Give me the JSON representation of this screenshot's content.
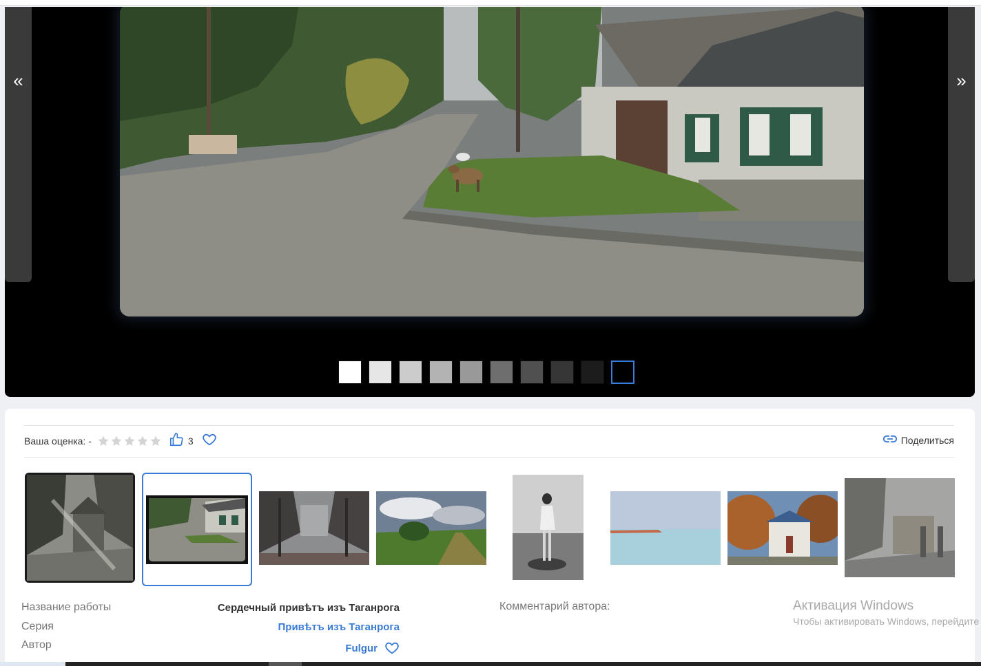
{
  "viewer": {
    "prev_label": "«",
    "next_label": "»",
    "background_swatches": [
      "#ffffff",
      "#e6e6e6",
      "#cccccc",
      "#b3b3b3",
      "#999999",
      "#6e6e6e",
      "#505050",
      "#363636",
      "#1c1c1c",
      "#000000"
    ],
    "active_swatch_index": 9
  },
  "toolbar": {
    "rating_label": "Ваша оценка: -",
    "star_count": 5,
    "like_count": "3",
    "share_label": "Поделиться"
  },
  "thumbnails": [
    {
      "name": "thumb-overgrown-church",
      "selected": false
    },
    {
      "name": "thumb-taganrog-street",
      "selected": true
    },
    {
      "name": "thumb-foggy-alley",
      "selected": false
    },
    {
      "name": "thumb-field-road",
      "selected": false
    },
    {
      "name": "thumb-woman-on-rock",
      "selected": false
    },
    {
      "name": "thumb-sea-horizon",
      "selected": false
    },
    {
      "name": "thumb-autumn-mansion",
      "selected": false
    },
    {
      "name": "thumb-snowy-street",
      "selected": false
    }
  ],
  "details": {
    "title_label": "Название работы",
    "series_label": "Серия",
    "author_label": "Автор",
    "title_value": "Сердечный привѣтъ изъ Таганрога",
    "series_value": "Привѣтъ изъ Таганрога",
    "author_value": "Fulgur",
    "comment_label": "Комментарий автора:"
  },
  "system": {
    "watermark_title": "Активация Windows",
    "watermark_sub": "Чтобы активировать Windows, перейдите"
  },
  "colors": {
    "accent": "#3a7bd5",
    "viewer_bg": "#000000"
  }
}
